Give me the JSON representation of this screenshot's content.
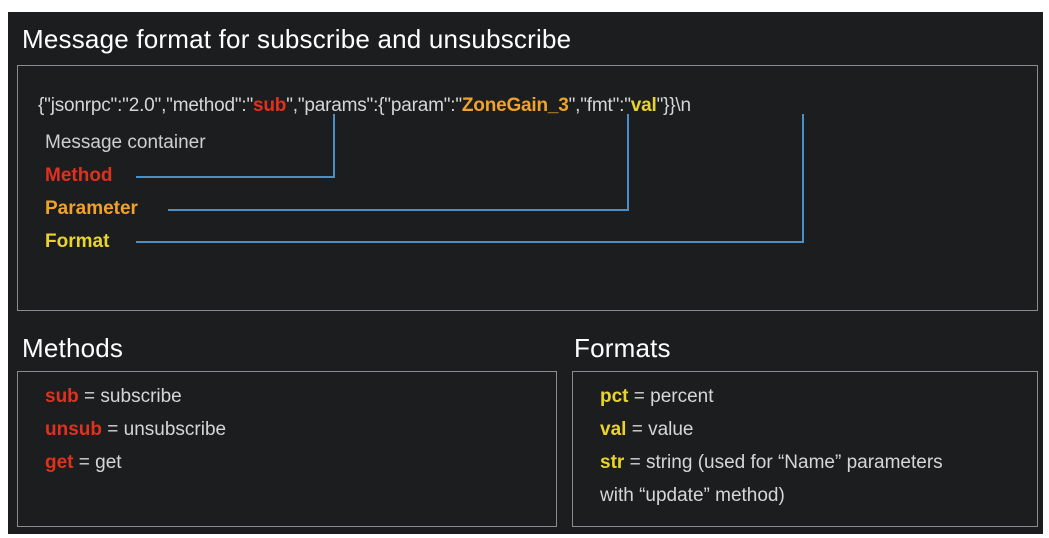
{
  "main_title": "Message format for subscribe and unsubscribe",
  "json_message": {
    "prefix": "{\"jsonrpc\":\"2.0\",\"method\":\"",
    "method": "sub",
    "middle": "\",\"params\":{\"param\":\"",
    "parameter": "ZoneGain_3",
    "middle2": "\",\"fmt\":\"",
    "format": "val",
    "suffix": "\"}}\\n"
  },
  "legend": {
    "container": "Message container",
    "method": "Method",
    "parameter": "Parameter",
    "format": "Format"
  },
  "methods": {
    "title": "Methods",
    "items": [
      {
        "key": "sub",
        "desc": " = subscribe"
      },
      {
        "key": "unsub",
        "desc": " = unsubscribe"
      },
      {
        "key": "get",
        "desc": " = get"
      }
    ]
  },
  "formats": {
    "title": "Formats",
    "items": [
      {
        "key": "pct",
        "desc": " = percent"
      },
      {
        "key": "val",
        "desc": " = value"
      },
      {
        "key": "str",
        "desc": " = string (used for “Name” parameters"
      }
    ],
    "continuation": "with “update” method)"
  },
  "colors": {
    "background": "#1c1d1f",
    "border": "#8a8c90",
    "method": "#e0311e",
    "parameter": "#f0a22a",
    "format": "#e9d42d",
    "connector": "#4a90c8"
  }
}
